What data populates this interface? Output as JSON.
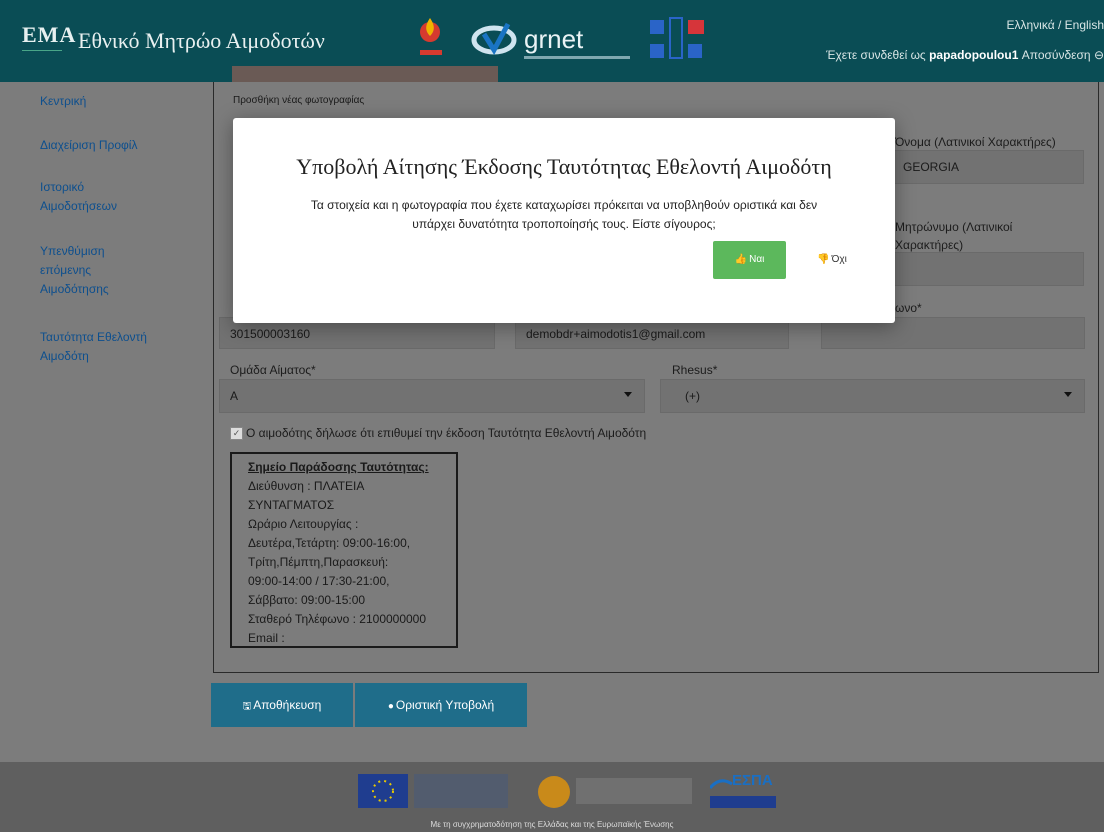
{
  "header": {
    "logo_text": "EMA",
    "site_title": "Εθνικό Μητρώο Αιμοδοτών",
    "partner_logo_text": "grnet",
    "language": "Ελληνικά / English",
    "user_prefix": "Έχετε συνδεθεί ως ",
    "username": "papadopoulou1",
    "logout": "Αποσύνδεση"
  },
  "sidebar": {
    "items": [
      {
        "label": "Κεντρική"
      },
      {
        "label": "Διαχείριση Προφίλ"
      },
      {
        "label": "Ιστορικό Αιμοδοτήσεων"
      },
      {
        "label": "Υπενθύμιση επόμενης Αιμοδότησης"
      },
      {
        "label": "Ταυτότητα Εθελοντή Αιμοδότη"
      }
    ]
  },
  "form": {
    "add_photo": "Προσθήκη νέας φωτογραφίας",
    "first_name_latin_label": "Όνομα (Λατινικοί Χαρακτήρες)",
    "first_name_latin_value": "GEORGIA",
    "mother_name_latin_label": "Μητρώνυμο (Λατινικοί Χαρακτήρες)",
    "mother_name_latin_value": "",
    "phone_label_fragment": "ωνο*",
    "amka_value": "301500003160",
    "email_value": "demobdr+aimodotis1@gmail.com",
    "blood_group_label": "Ομάδα Αίματος*",
    "blood_group_value": "A",
    "rhesus_label": "Rhesus*",
    "rhesus_value": "(+)",
    "checkbox_label": "Ο αιμοδότης δήλωσε ότι επιθυμεί την έκδοση Ταυτότητα Εθελοντή Αιμοδότη",
    "delivery": {
      "title": "Σημείο Παράδοσης Ταυτότητας:",
      "lines": [
        "Διεύθυνση : ΠΛΑΤΕΙΑ",
        "ΣΥΝΤΑΓΜΑΤΟΣ",
        "Ωράριο Λειτουργίας :",
        "Δευτέρα,Τετάρτη: 09:00-16:00,",
        "Τρίτη,Πέμπτη,Παρασκευή:",
        "09:00-14:00 / 17:30-21:00,",
        "Σάββατο: 09:00-15:00",
        "Σταθερό Τηλέφωνο : 2100000000",
        "Email :"
      ]
    },
    "save_button": "Αποθήκευση",
    "submit_button": "Οριστική Υποβολή"
  },
  "modal": {
    "title": "Υποβολή Αίτησης Έκδοσης Ταυτότητας Εθελοντή Αιμοδότη",
    "body": "Τα στοιχεία και η φωτογραφία που έχετε καταχωρίσει πρόκειται να υποβληθούν οριστικά και δεν υπάρχει δυνατότητα τροποποίησής τους. Είστε σίγουρος;",
    "yes": "Ναι",
    "no": "Όχι"
  },
  "footer": {
    "caption": "Με τη συγχρηματοδότηση της Ελλάδας και της Ευρωπαϊκής Ένωσης",
    "espa": "ΕΣΠΑ"
  },
  "colors": {
    "header_bg": "#0a4d55",
    "link": "#0d4f8e",
    "primary_button": "#1f6d8a",
    "success": "#5cb85c"
  }
}
